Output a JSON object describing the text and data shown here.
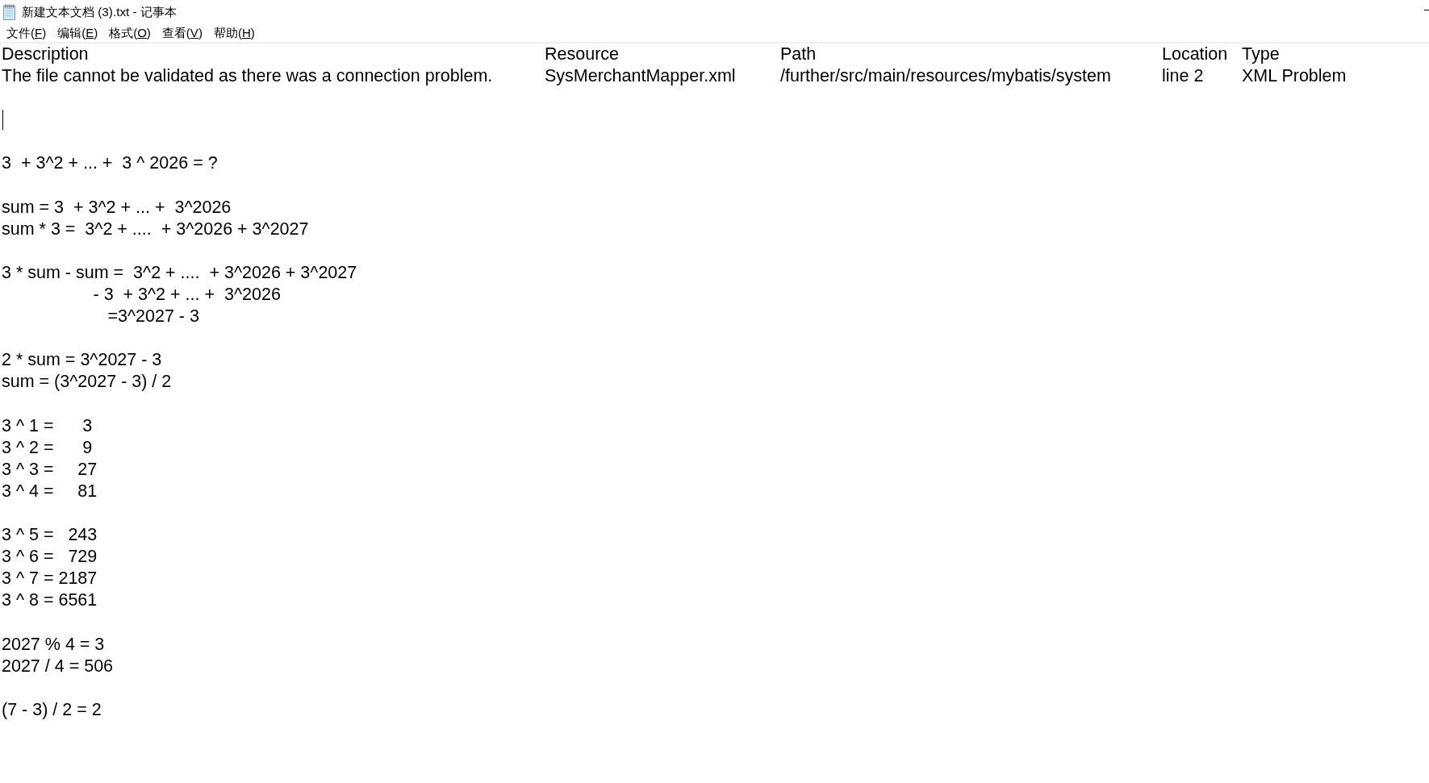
{
  "window": {
    "title": "新建文本文档 (3).txt - 记事本"
  },
  "menu": [
    {
      "before": "文件(",
      "access_key": "F",
      "after": ")"
    },
    {
      "before": "编辑(",
      "access_key": "E",
      "after": ")"
    },
    {
      "before": "格式(",
      "access_key": "O",
      "after": ")"
    },
    {
      "before": "查看(",
      "access_key": "V",
      "after": ")"
    },
    {
      "before": "帮助(",
      "access_key": "H",
      "after": ")"
    }
  ],
  "document": {
    "problem_columns": [
      "Description",
      "Resource",
      "Path",
      "Location",
      "Type"
    ],
    "problem_row": [
      "The file cannot be validated as there was a connection problem.",
      "SysMerchantMapper.xml",
      "/further/src/main/resources/mybatis/system",
      "line 2",
      "XML Problem"
    ],
    "paragraphs": [
      [
        "3  + 3^2 + ... +  3 ^ 2026 = ?"
      ],
      [
        "sum = 3  + 3^2 + ... +  3^2026",
        "sum * 3 =  3^2 + ....  + 3^2026 + 3^2027"
      ],
      [
        "3 * sum - sum =  3^2 + ....  + 3^2026 + 3^2027",
        "                   - 3  + 3^2 + ... +  3^2026",
        "                      =3^2027 - 3"
      ],
      [
        "2 * sum = 3^2027 - 3",
        "sum = (3^2027 - 3) / 2"
      ],
      [
        "3 ^ 1 =      3",
        "3 ^ 2 =      9",
        "3 ^ 3 =     27",
        "3 ^ 4 =     81"
      ],
      [
        "3 ^ 5 =   243",
        "3 ^ 6 =   729",
        "3 ^ 7 = 2187",
        "3 ^ 8 = 6561"
      ],
      [
        "2027 % 4 = 3",
        "2027 / 4 = 506"
      ],
      [
        "(7 - 3) / 2 = 2"
      ]
    ]
  }
}
